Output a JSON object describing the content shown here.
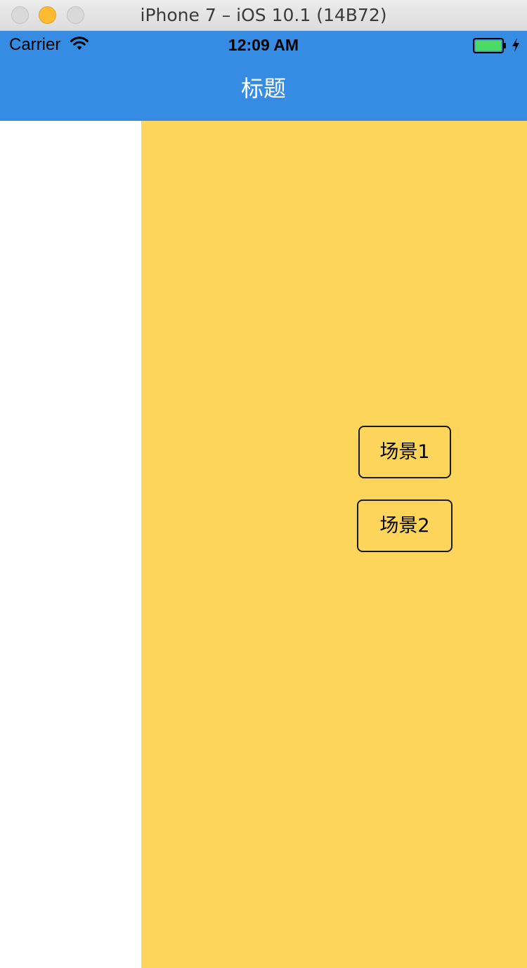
{
  "window": {
    "title": "iPhone 7 – iOS 10.1 (14B72)"
  },
  "status_bar": {
    "carrier": "Carrier",
    "time": "12:09 AM",
    "wifi_icon": "wifi-icon",
    "battery_icon": "battery-icon",
    "charging_icon": "charging-bolt-icon"
  },
  "nav_bar": {
    "title": "标题"
  },
  "main": {
    "buttons": [
      {
        "label": "场景1"
      },
      {
        "label": "场景2"
      }
    ]
  },
  "colors": {
    "nav_bar": "#368ce3",
    "main_panel": "#fdd55a",
    "side_panel": "#ffffff",
    "battery_fill": "#4cd964"
  }
}
